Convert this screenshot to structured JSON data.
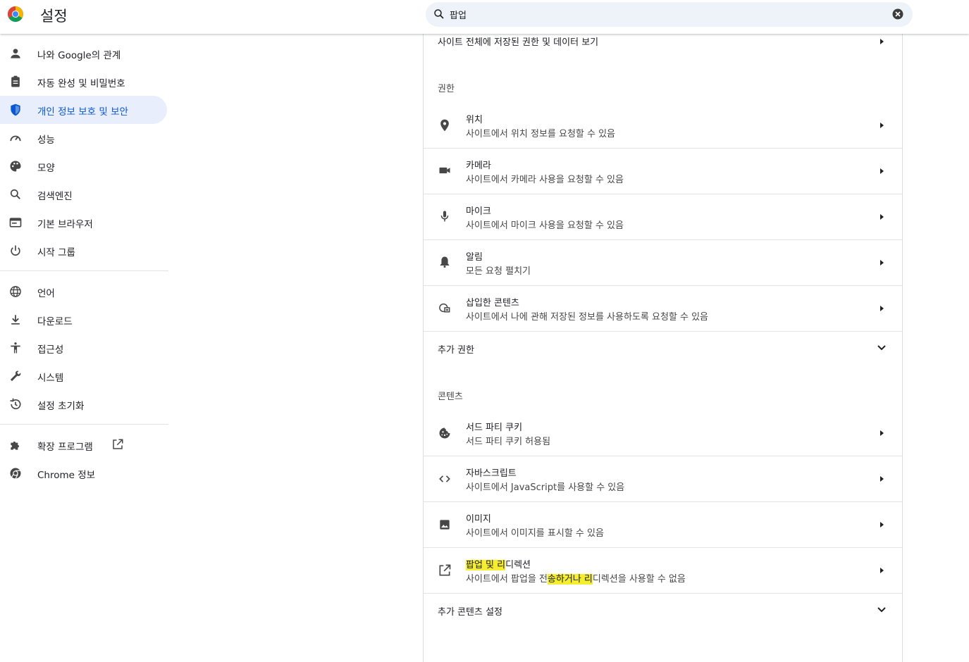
{
  "header": {
    "title": "설정",
    "search_value": "팝업"
  },
  "sidebar": {
    "items": [
      {
        "label": "나와 Google의 관계",
        "icon": "person-icon"
      },
      {
        "label": "자동 완성 및 비밀번호",
        "icon": "clipboard-icon"
      },
      {
        "label": "개인 정보 보호 및 보안",
        "icon": "shield-icon",
        "active": true
      },
      {
        "label": "성능",
        "icon": "speedometer-icon"
      },
      {
        "label": "모양",
        "icon": "palette-icon"
      },
      {
        "label": "검색엔진",
        "icon": "search-icon"
      },
      {
        "label": "기본 브라우저",
        "icon": "browser-icon"
      },
      {
        "label": "시작 그룹",
        "icon": "power-icon"
      },
      {
        "label": "언어",
        "icon": "globe-icon"
      },
      {
        "label": "다운로드",
        "icon": "download-icon"
      },
      {
        "label": "접근성",
        "icon": "accessibility-icon"
      },
      {
        "label": "시스템",
        "icon": "wrench-icon"
      },
      {
        "label": "설정 초기화",
        "icon": "history-icon"
      },
      {
        "label": "확장 프로그램",
        "icon": "puzzle-icon"
      },
      {
        "label": "Chrome 정보",
        "icon": "chrome-icon"
      }
    ]
  },
  "main": {
    "site_data_row": "사이트 전체에 저장된 권한 및 데이터 보기",
    "permissions_heading": "권한",
    "permissions": [
      {
        "title": "위치",
        "sub": "사이트에서 위치 정보를 요청할 수 있음",
        "icon": "location-pin-icon"
      },
      {
        "title": "카메라",
        "sub": "사이트에서 카메라 사용을 요청할 수 있음",
        "icon": "camera-icon"
      },
      {
        "title": "마이크",
        "sub": "사이트에서 마이크 사용을 요청할 수 있음",
        "icon": "microphone-icon"
      },
      {
        "title": "알림",
        "sub": "모든 요청 펼치기",
        "icon": "bell-icon"
      },
      {
        "title": "삽입한 콘텐츠",
        "sub": "사이트에서 나에 관해 저장된 정보를 사용하도록 요청할 수 있음",
        "icon": "embedded-content-icon"
      }
    ],
    "more_permissions": "추가 권한",
    "content_heading": "콘텐츠",
    "content": [
      {
        "title": "서드 파티 쿠키",
        "sub": "서드 파티 쿠키 허용됨",
        "icon": "cookie-icon"
      },
      {
        "title": "자바스크립트",
        "sub": "사이트에서 JavaScript를 사용할 수 있음",
        "icon": "code-icon"
      },
      {
        "title": "이미지",
        "sub": "사이트에서 이미지를 표시할 수 있음",
        "icon": "image-icon"
      }
    ],
    "popups": {
      "title_hl": "팝업 및 리",
      "title_rest": "디렉션",
      "sub_pre": "사이트에서 팝업을 전",
      "sub_hl": "송하거나 리",
      "sub_post": "디렉션을 사용할 수 없음",
      "icon": "open-in-new-icon"
    },
    "more_content": "추가 콘텐츠 설정"
  },
  "colors": {
    "accent": "#0b57d0",
    "active_bg": "#e8eefb",
    "highlight": "#f5ed2f",
    "search_bg": "#eef2f9"
  }
}
